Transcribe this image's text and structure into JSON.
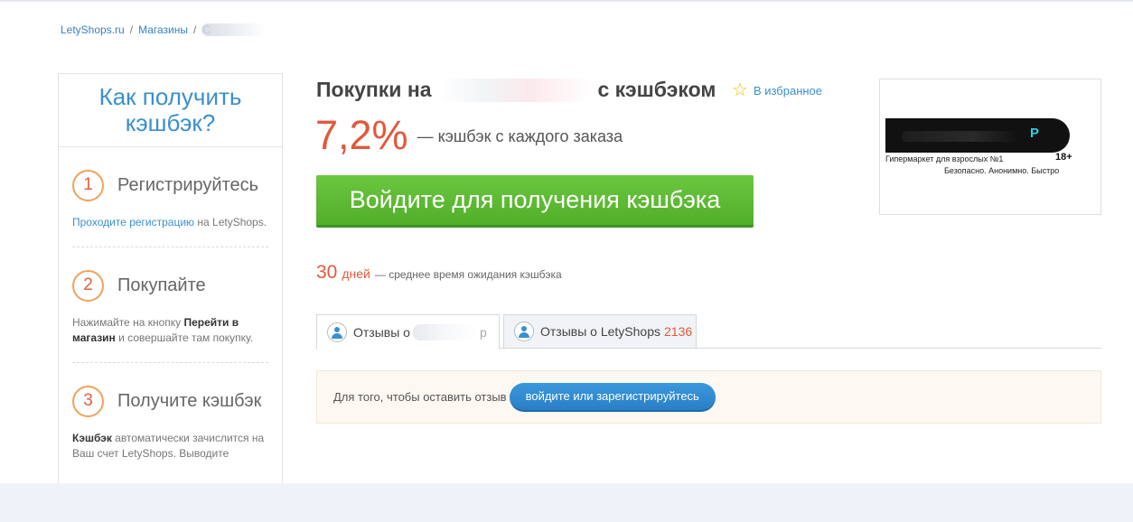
{
  "breadcrumb": {
    "home": "LetyShops.ru",
    "separator": "/",
    "shops": "Магазины",
    "current": "С"
  },
  "sidebar": {
    "title": "Как получить кэшбэк?",
    "steps": [
      {
        "number": "1",
        "label": "Регистрируйтесь",
        "text_link": "Проходите регистрацию",
        "text_rest": " на LetyShops."
      },
      {
        "number": "2",
        "label": "Покупайте",
        "text_pre": "Нажимайте на кнопку ",
        "text_bold": "Перейти в магазин",
        "text_rest": " и совершайте там покупку."
      },
      {
        "number": "3",
        "label": "Получите кэшбэк",
        "text_bold": "Кэшбэк",
        "text_rest": " автоматически зачислится на Ваш счет LetyShops. Выводите"
      }
    ]
  },
  "main": {
    "title_prefix": "Покупки на",
    "title_suffix": "с кэшбэком",
    "favorite_label": "В избранное",
    "cashback_percent": "7,2%",
    "cashback_desc": "— кэшбэк с каждого заказа",
    "login_button": "Войдите для получения кэшбэка",
    "wait_number": "30",
    "wait_unit": "дней",
    "wait_desc": "— среднее время ожидания кэшбэка"
  },
  "tabs": [
    {
      "label": "Отзывы о",
      "tail": "р",
      "active": true
    },
    {
      "label": "Отзывы о LetyShops",
      "count": "2136",
      "active": false
    }
  ],
  "review": {
    "prompt": "Для того, чтобы оставить отзыв",
    "button": "войдите или зарегистрируйтесь"
  },
  "ad": {
    "logo_letter": "P",
    "age": "18+",
    "line1": "Гипермаркет для взрослых №1",
    "line2": "Безопасно. Анонимно. Быстро"
  },
  "colors": {
    "accent_blue": "#3a8fd0",
    "accent_orange": "#e0593b",
    "button_green": "#5cb932",
    "button_blue": "#2f8bd2"
  }
}
